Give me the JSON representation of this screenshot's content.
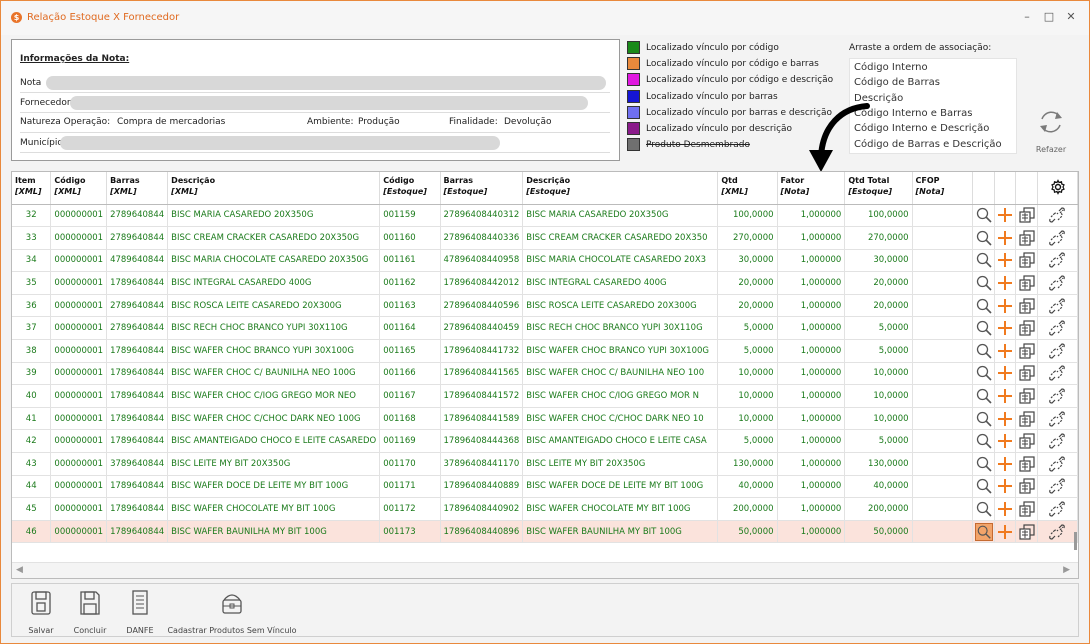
{
  "window": {
    "title": "Relação Estoque X Fornecedor",
    "minimize": "–",
    "maximize": "□",
    "close": "✕"
  },
  "nota": {
    "title": "Informações da Nota:",
    "nota_label": "Nota",
    "fornecedor_label": "Fornecedor",
    "natureza_label": "Natureza Operação:",
    "natureza_value": "Compra de mercadorias",
    "ambiente_label": "Ambiente:",
    "ambiente_value": "Produção",
    "finalidade_label": "Finalidade:",
    "finalidade_value": "Devolução",
    "municipio_label": "Município"
  },
  "legend": [
    {
      "label": "Localizado vínculo por código",
      "color": "#1a8a1a",
      "strike": false
    },
    {
      "label": "Localizado vínculo por código e barras",
      "color": "#e9893c",
      "strike": false
    },
    {
      "label": "Localizado vínculo por código e descrição",
      "color": "#e018e0",
      "strike": false
    },
    {
      "label": "Localizado vínculo por barras",
      "color": "#1515d6",
      "strike": false
    },
    {
      "label": "Localizado vínculo por barras e descrição",
      "color": "#7070f0",
      "strike": false
    },
    {
      "label": "Localizado vínculo por descrição",
      "color": "#8a1a8a",
      "strike": false
    },
    {
      "label": "Produto Desmembrado",
      "color": "#707070",
      "strike": true
    }
  ],
  "association": {
    "title": "Arraste a ordem de associação:",
    "items": [
      "Código Interno",
      "Código de Barras",
      "Descrição",
      "Código Interno e Barras",
      "Código Interno e Descrição",
      "Código de Barras e Descrição"
    ],
    "refazer_label": "Refazer"
  },
  "table": {
    "headers": [
      {
        "title": "Item",
        "sub": "[XML]"
      },
      {
        "title": "Código",
        "sub": "[XML]"
      },
      {
        "title": "Barras",
        "sub": "[XML]"
      },
      {
        "title": "Descrição",
        "sub": "[XML]"
      },
      {
        "title": "Código",
        "sub": "[Estoque]"
      },
      {
        "title": "Barras",
        "sub": "[Estoque]"
      },
      {
        "title": "Descrição",
        "sub": "[Estoque]"
      },
      {
        "title": "Qtd",
        "sub": "[XML]"
      },
      {
        "title": "Fator",
        "sub": "[Nota]"
      },
      {
        "title": "Qtd Total",
        "sub": "[Estoque]"
      },
      {
        "title": "CFOP",
        "sub": "[Nota]"
      }
    ],
    "rows": [
      [
        "32",
        "000000001",
        "2789640844",
        "BISC MARIA CASAREDO 20X350G",
        "001159",
        "27896408440312",
        "BISC MARIA CASAREDO 20X350G",
        "100,0000",
        "1,000000",
        "100,0000",
        ""
      ],
      [
        "33",
        "000000001",
        "2789640844",
        "BISC CREAM CRACKER CASAREDO 20X350G",
        "001160",
        "27896408440336",
        "BISC CREAM CRACKER CASAREDO 20X350",
        "270,0000",
        "1,000000",
        "270,0000",
        ""
      ],
      [
        "34",
        "000000001",
        "4789640844",
        "BISC MARIA CHOCOLATE CASAREDO 20X350G",
        "001161",
        "47896408440958",
        "BISC MARIA CHOCOLATE CASAREDO 20X3",
        "30,0000",
        "1,000000",
        "30,0000",
        ""
      ],
      [
        "35",
        "000000001",
        "1789640844",
        "BISC INTEGRAL CASAREDO 400G",
        "001162",
        "17896408442012",
        "BISC INTEGRAL CASAREDO 400G",
        "20,0000",
        "1,000000",
        "20,0000",
        ""
      ],
      [
        "36",
        "000000001",
        "2789640844",
        "BISC ROSCA LEITE CASAREDO 20X300G",
        "001163",
        "27896408440596",
        "BISC ROSCA LEITE CASAREDO 20X300G",
        "20,0000",
        "1,000000",
        "20,0000",
        ""
      ],
      [
        "37",
        "000000001",
        "2789640844",
        "BISC RECH CHOC BRANCO YUPI 30X110G",
        "001164",
        "27896408440459",
        "BISC RECH CHOC BRANCO YUPI 30X110G",
        "5,0000",
        "1,000000",
        "5,0000",
        ""
      ],
      [
        "38",
        "000000001",
        "1789640844",
        "BISC WAFER CHOC BRANCO YUPI 30X100G",
        "001165",
        "17896408441732",
        "BISC WAFER CHOC BRANCO YUPI 30X100G",
        "5,0000",
        "1,000000",
        "5,0000",
        ""
      ],
      [
        "39",
        "000000001",
        "1789640844",
        "BISC WAFER CHOC C/ BAUNILHA NEO 100G",
        "001166",
        "17896408441565",
        "BISC WAFER CHOC C/ BAUNILHA NEO 100",
        "10,0000",
        "1,000000",
        "10,0000",
        ""
      ],
      [
        "40",
        "000000001",
        "1789640844",
        "BISC WAFER CHOC C/IOG GREGO MOR NEO",
        "001167",
        "17896408441572",
        "BISC WAFER CHOC C/IOG GREGO MOR N",
        "10,0000",
        "1,000000",
        "10,0000",
        ""
      ],
      [
        "41",
        "000000001",
        "1789640844",
        "BISC WAFER CHOC C/CHOC DARK NEO 100G",
        "001168",
        "17896408441589",
        "BISC WAFER CHOC C/CHOC DARK NEO 10",
        "10,0000",
        "1,000000",
        "10,0000",
        ""
      ],
      [
        "42",
        "000000001",
        "1789640844",
        "BISC AMANTEIGADO CHOCO E LEITE CASAREDO",
        "001169",
        "17896408444368",
        "BISC AMANTEIGADO CHOCO E LEITE CASA",
        "5,0000",
        "1,000000",
        "5,0000",
        ""
      ],
      [
        "43",
        "000000001",
        "3789640844",
        "BISC LEITE MY BIT 20X350G",
        "001170",
        "37896408441170",
        "BISC LEITE MY BIT 20X350G",
        "130,0000",
        "1,000000",
        "130,0000",
        ""
      ],
      [
        "44",
        "000000001",
        "1789640844",
        "BISC WAFER DOCE DE LEITE MY BIT 100G",
        "001171",
        "17896408440889",
        "BISC WAFER DOCE DE LEITE MY BIT 100G",
        "40,0000",
        "1,000000",
        "40,0000",
        ""
      ],
      [
        "45",
        "000000001",
        "1789640844",
        "BISC WAFER CHOCOLATE MY BIT 100G",
        "001172",
        "17896408440902",
        "BISC WAFER CHOCOLATE MY BIT 100G",
        "200,0000",
        "1,000000",
        "200,0000",
        ""
      ],
      [
        "46",
        "000000001",
        "1789640844",
        "BISC WAFER BAUNILHA MY BIT 100G",
        "001173",
        "17896408440896",
        "BISC WAFER BAUNILHA MY BIT 100G",
        "50,0000",
        "1,000000",
        "50,0000",
        ""
      ]
    ],
    "selected_index": 14
  },
  "toolbar": {
    "salvar": "Salvar",
    "concluir": "Concluir",
    "danfe": "DANFE",
    "cadastrar": "Cadastrar Produtos Sem Vínculo"
  },
  "icons": [
    "app-logo-icon",
    "search-icon",
    "plus-icon",
    "split-icon",
    "unlink-icon",
    "settings-gear-icon",
    "refresh-icon",
    "save-icon",
    "floppy-icon",
    "document-icon",
    "register-box-icon"
  ]
}
